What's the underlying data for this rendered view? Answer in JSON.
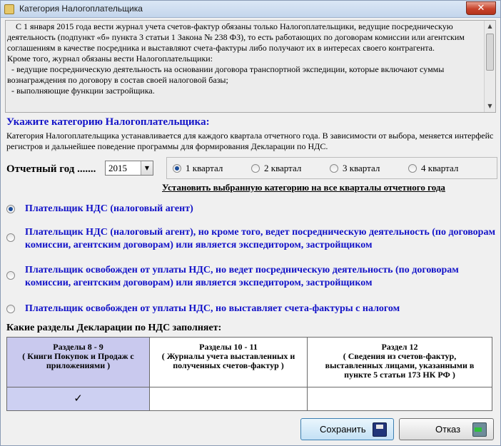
{
  "window": {
    "title": "Категория Налогоплательщика",
    "close_label": "✕"
  },
  "info": {
    "paragraphs": [
      "    С 1 января 2015 года вести журнал учета счетов-фактур обязаны только Налогоплательщики, ведущие посредническую деятельность (подпункт «б» пункта 3 статьи 1 Закона № 238 ФЗ), то есть работающих по договорам комиссии или агентским соглашениям в качестве посредника и выставляют счета-фактуры либо получают их в интересах своего контрагента.",
      "Кроме того, журнал обязаны вести Налогоплательщики:",
      "  - ведущие посредническую деятельность на основании договора транспортной экспедиции, которые включают суммы вознаграждения по договору в состав своей налоговой базы;",
      "  - выполняющие функции застройщика."
    ]
  },
  "category": {
    "heading": "Укажите категорию Налогоплательщика:",
    "description": "Категория Налогоплательщика устанавливается для каждого квартала отчетного года. В зависимости от выбора, меняется интерфейс регистров и дальнейшее поведение программы для формирования Декларации по НДС."
  },
  "year": {
    "label": "Отчетный год .......",
    "value": "2015",
    "arrow": "▼"
  },
  "quarters": [
    {
      "label": "1 квартал",
      "checked": true
    },
    {
      "label": "2 квартал",
      "checked": false
    },
    {
      "label": "3 квартал",
      "checked": false
    },
    {
      "label": "4 квартал",
      "checked": false
    }
  ],
  "set_all_label": "Установить выбранную категорию на все кварталы отчетного года",
  "options": [
    {
      "label": "Плательщик НДС (налоговый агент)",
      "checked": true
    },
    {
      "label": "Плательщик НДС (налоговый агент), но кроме того, ведет посредническую деятельность (по договорам комиссии, агентским договорам) или является  экспедитором, застройщиком",
      "checked": false
    },
    {
      "label": "Плательщик освобожден от уплаты НДС, но ведет посредническую деятельность (по договорам комиссии, агентским договорам) или является  экспедитором, застройщиком",
      "checked": false
    },
    {
      "label": "Плательщик освобожден от уплаты НДС, но выставляет счета-фактуры с налогом",
      "checked": false
    }
  ],
  "sections": {
    "heading": "Какие разделы Декларации по НДС заполняет:",
    "columns": [
      {
        "title": "Разделы 8 - 9",
        "subtitle": "( Книги Покупок и Продаж с приложениями )",
        "mark": "✓",
        "active": true
      },
      {
        "title": "Разделы 10 - 11",
        "subtitle": "( Журналы учета выставленных и полученных счетов-фактур )",
        "mark": "",
        "active": false
      },
      {
        "title": "Раздел 12",
        "subtitle": "( Сведения из счетов-фактур, выставленных лицами, указанными в пункте 5 статьи 173 НК РФ )",
        "mark": "",
        "active": false
      }
    ]
  },
  "buttons": {
    "save_label": "Сохранить",
    "cancel_label": "Отказ"
  },
  "scrollbar": {
    "up_arrow": "▲",
    "down_arrow": "▼"
  }
}
